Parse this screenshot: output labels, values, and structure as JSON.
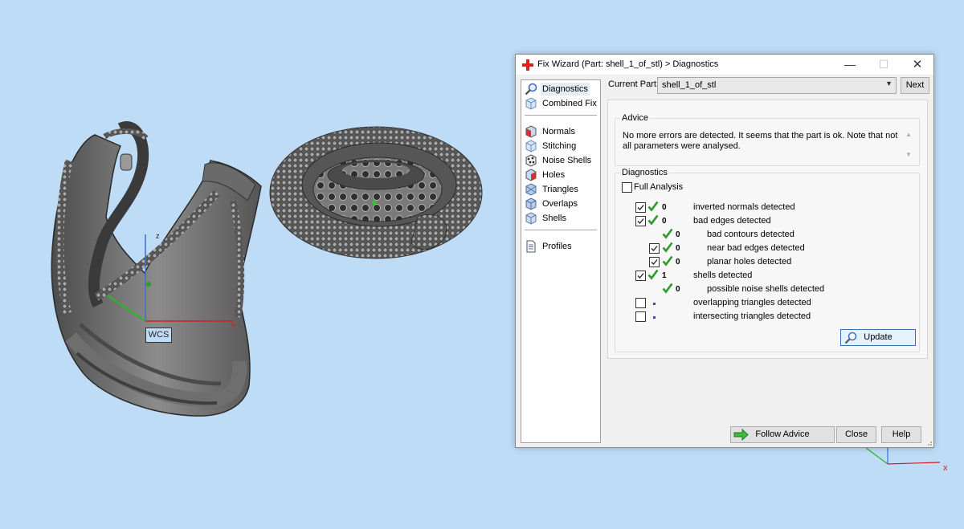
{
  "window": {
    "title": "Fix Wizard (Part: shell_1_of_stl) > Diagnostics",
    "minimize": "—",
    "maximize": "☐",
    "close": "✕"
  },
  "viewport": {
    "wcs_label": "WCS",
    "axis_z": "z",
    "axis_x": "x"
  },
  "nav": {
    "items": [
      {
        "label": "Diagnostics",
        "icon": "magnifier-icon",
        "selected": true
      },
      {
        "label": "Combined Fix",
        "icon": "cube-icon"
      },
      {
        "label": "Normals",
        "icon": "normals-cube-icon"
      },
      {
        "label": "Stitching",
        "icon": "stitching-cube-icon"
      },
      {
        "label": "Noise Shells",
        "icon": "noise-shells-icon"
      },
      {
        "label": "Holes",
        "icon": "holes-cube-icon"
      },
      {
        "label": "Triangles",
        "icon": "triangles-cube-icon"
      },
      {
        "label": "Overlaps",
        "icon": "overlaps-cube-icon"
      },
      {
        "label": "Shells",
        "icon": "shells-cube-icon"
      },
      {
        "label": "Profiles",
        "icon": "document-icon"
      }
    ]
  },
  "current_part": {
    "label": "Current Part:",
    "value": "shell_1_of_stl",
    "next": "Next"
  },
  "advice": {
    "title": "Advice",
    "text": "No more errors are detected. It seems that the part is ok. Note that not all parameters were analysed."
  },
  "diagnostics": {
    "title": "Diagnostics",
    "full_analysis": "Full Analysis",
    "rows": [
      {
        "checkbox": true,
        "checked": true,
        "status": "ok",
        "count": "0",
        "label": "inverted normals detected"
      },
      {
        "checkbox": true,
        "checked": true,
        "status": "ok",
        "count": "0",
        "label": "bad edges detected"
      },
      {
        "checkbox": false,
        "status": "ok",
        "count": "0",
        "label": "bad contours detected"
      },
      {
        "checkbox": true,
        "checked": true,
        "status": "ok",
        "count": "0",
        "label": "near bad edges detected"
      },
      {
        "checkbox": true,
        "checked": true,
        "status": "ok",
        "count": "0",
        "label": "planar holes detected"
      },
      {
        "checkbox": true,
        "checked": true,
        "status": "ok",
        "count": "1",
        "label": "shells detected"
      },
      {
        "checkbox": false,
        "status": "ok",
        "count": "0",
        "label": "possible noise shells detected"
      },
      {
        "checkbox": true,
        "checked": false,
        "status": "pending",
        "count": "",
        "label": "overlapping triangles detected"
      },
      {
        "checkbox": true,
        "checked": false,
        "status": "pending",
        "count": "",
        "label": "intersecting triangles detected"
      }
    ],
    "update": "Update"
  },
  "footer": {
    "follow_advice": "Follow Advice",
    "close": "Close",
    "help": "Help"
  },
  "colors": {
    "background": "#bfdcf7",
    "check_green": "#2e9a2e",
    "accent_blue": "#3d6fb5",
    "axis_red": "#d22020",
    "axis_green": "#22bb22"
  }
}
